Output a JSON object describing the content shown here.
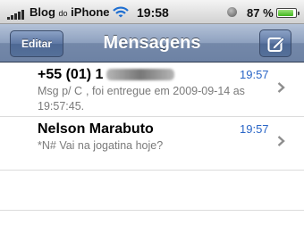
{
  "status_bar": {
    "carrier": "Blog",
    "carrier_small": "do",
    "carrier_suffix": "iPhone",
    "time": "19:58",
    "battery_percent": "87 %",
    "battery_level": 0.87,
    "signal_bars": 5,
    "icons": [
      "signal-bars-icon",
      "wifi-icon",
      "orientation-lock-icon",
      "battery-icon"
    ]
  },
  "nav_bar": {
    "edit_label": "Editar",
    "title": "Mensagens",
    "compose_icon": "compose-icon"
  },
  "messages": [
    {
      "sender": "+55 (01) 1",
      "time": "19:57",
      "preview_start": "Msg p/ C",
      "preview_end": ", foi entregue em 2009-09-14 as 19:57:45."
    },
    {
      "sender": "Nelson Marabuto",
      "time": "19:57",
      "preview": "*N# Vai na jogatina hoje?"
    }
  ],
  "colors": {
    "nav_bar": "#7a8eb0",
    "time_text": "#2a66c7",
    "preview_text": "#7a7a7a"
  }
}
